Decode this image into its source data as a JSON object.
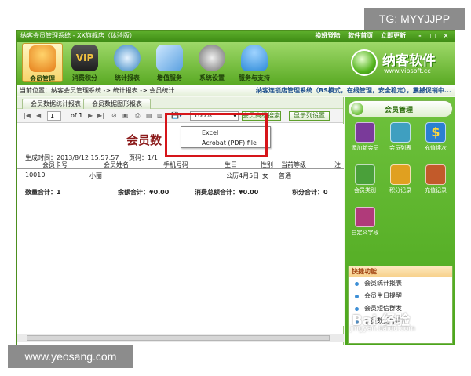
{
  "watermarks": {
    "top": "TG: MYYJJPP",
    "bottom": "www.yeosang.com",
    "baidu": "Bai 经验",
    "baidu_sub": "jingyan.baidu.com"
  },
  "window": {
    "title": "纳客会员管理系统 - XX旗舰店（体验版）",
    "links": [
      "换班登陆",
      "软件首页",
      "立即更新"
    ],
    "controls": [
      "-",
      "□",
      "×"
    ]
  },
  "toolbar": {
    "items": [
      {
        "label": "会员管理",
        "color": "#e57d1a"
      },
      {
        "label": "消费积分",
        "color": "#3b3b3b"
      },
      {
        "label": "统计报表",
        "color": "#2f7fbf"
      },
      {
        "label": "增值服务",
        "color": "#5aa0e0"
      },
      {
        "label": "系统设置",
        "color": "#6b6b6b"
      },
      {
        "label": "服务与支持",
        "color": "#2d8ad8"
      }
    ],
    "logo_text": "纳客软件",
    "logo_url": "www.vipsoft.cc"
  },
  "breadcrumb": {
    "text": "当前位置：纳客会员管理系统 -> 统计报表 -> 会员统计",
    "right": "纳客连锁店管理系统（BS模式，在线管理，安全稳定），震撼促销中..."
  },
  "tabs": [
    "会员数据统计报表",
    "会员数据图形报表"
  ],
  "report_toolbar": {
    "page": "1",
    "of": "of 1",
    "zoom": "100%",
    "buttons": [
      "会员高级搜索",
      "显示列设置"
    ]
  },
  "export_menu": [
    "Excel",
    "Acrobat (PDF) file"
  ],
  "report": {
    "title": "会员数",
    "generated": "生成时间：2013/8/12 15:57:57",
    "page": "页码：1/1",
    "columns": [
      "会员卡号",
      "会员姓名",
      "手机号码",
      "生日",
      "性别",
      "当前等级",
      "注"
    ],
    "rows": [
      [
        "10010",
        "小丽",
        "",
        "公历4月5日",
        "女",
        "普通",
        ""
      ]
    ],
    "totals": [
      "数量合计：1",
      "余额合计：¥0.00",
      "消费总额合计：¥0.00",
      "积分合计：0"
    ]
  },
  "sidebar": {
    "header": "会员管理",
    "items": [
      {
        "label": "添加新会员",
        "color": "#7a3a9a"
      },
      {
        "label": "会员列表",
        "color": "#3f9fc0"
      },
      {
        "label": "充值续次",
        "color": "#2b7fd1"
      },
      {
        "label": "会员类别",
        "color": "#4aa03a"
      },
      {
        "label": "积分记录",
        "color": "#e0a020"
      },
      {
        "label": "充值记录",
        "color": "#c25a2a"
      },
      {
        "label": "自定义字段",
        "color": "#b03a7a"
      }
    ],
    "quick_header": "快捷功能",
    "quick_items": [
      "会员统计报表",
      "会员生日提醒",
      "会员短信群发",
      "会员数据导出"
    ]
  }
}
